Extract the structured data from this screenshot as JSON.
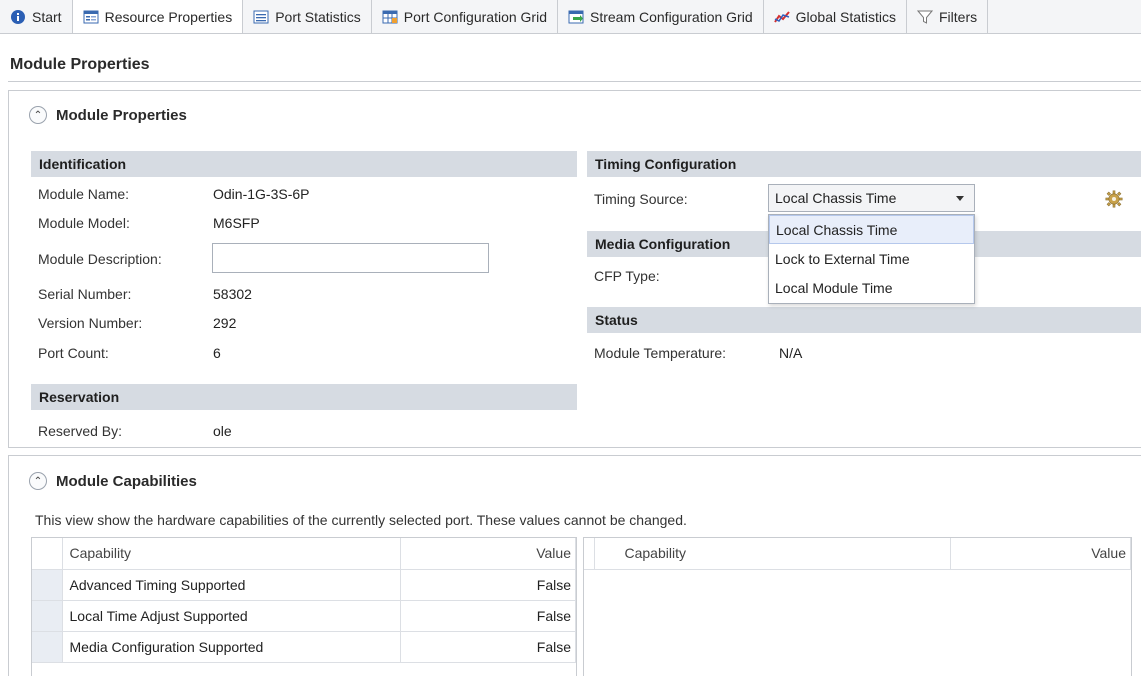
{
  "tabs": [
    {
      "label": "Start",
      "icon": "info-icon"
    },
    {
      "label": "Resource Properties",
      "icon": "properties-icon"
    },
    {
      "label": "Port Statistics",
      "icon": "list-icon"
    },
    {
      "label": "Port Configuration Grid",
      "icon": "grid-icon"
    },
    {
      "label": "Stream Configuration Grid",
      "icon": "stream-grid-icon"
    },
    {
      "label": "Global Statistics",
      "icon": "chart-icon"
    },
    {
      "label": "Filters",
      "icon": "filter-icon"
    }
  ],
  "page": {
    "title": "Module Properties"
  },
  "properties_panel": {
    "title": "Module Properties",
    "identification": {
      "heading": "Identification",
      "module_name_label": "Module Name:",
      "module_name": "Odin-1G-3S-6P",
      "module_model_label": "Module Model:",
      "module_model": "M6SFP",
      "module_description_label": "Module Description:",
      "module_description": "",
      "serial_number_label": "Serial Number:",
      "serial_number": "58302",
      "version_number_label": "Version Number:",
      "version_number": "292",
      "port_count_label": "Port Count:",
      "port_count": "6"
    },
    "reservation": {
      "heading": "Reservation",
      "reserved_by_label": "Reserved By:",
      "reserved_by": "ole"
    },
    "timing": {
      "heading": "Timing Configuration",
      "timing_source_label": "Timing Source:",
      "timing_source": "Local Chassis Time",
      "options": [
        "Local Chassis Time",
        "Lock to External Time",
        "Local Module Time"
      ]
    },
    "media": {
      "heading": "Media Configuration",
      "cfp_type_label": "CFP Type:"
    },
    "status": {
      "heading": "Status",
      "module_temperature_label": "Module Temperature:",
      "module_temperature": "N/A"
    }
  },
  "capabilities_panel": {
    "title": "Module Capabilities",
    "description": "This view show the hardware capabilities of the currently selected port. These values cannot be changed.",
    "left_grid": {
      "headers": {
        "capability": "Capability",
        "value": "Value"
      },
      "rows": [
        {
          "capability": "Advanced Timing Supported",
          "value": "False"
        },
        {
          "capability": "Local Time Adjust Supported",
          "value": "False"
        },
        {
          "capability": "Media Configuration Supported",
          "value": "False"
        }
      ]
    },
    "right_grid": {
      "headers": {
        "capability": "Capability",
        "value": "Value"
      }
    }
  }
}
